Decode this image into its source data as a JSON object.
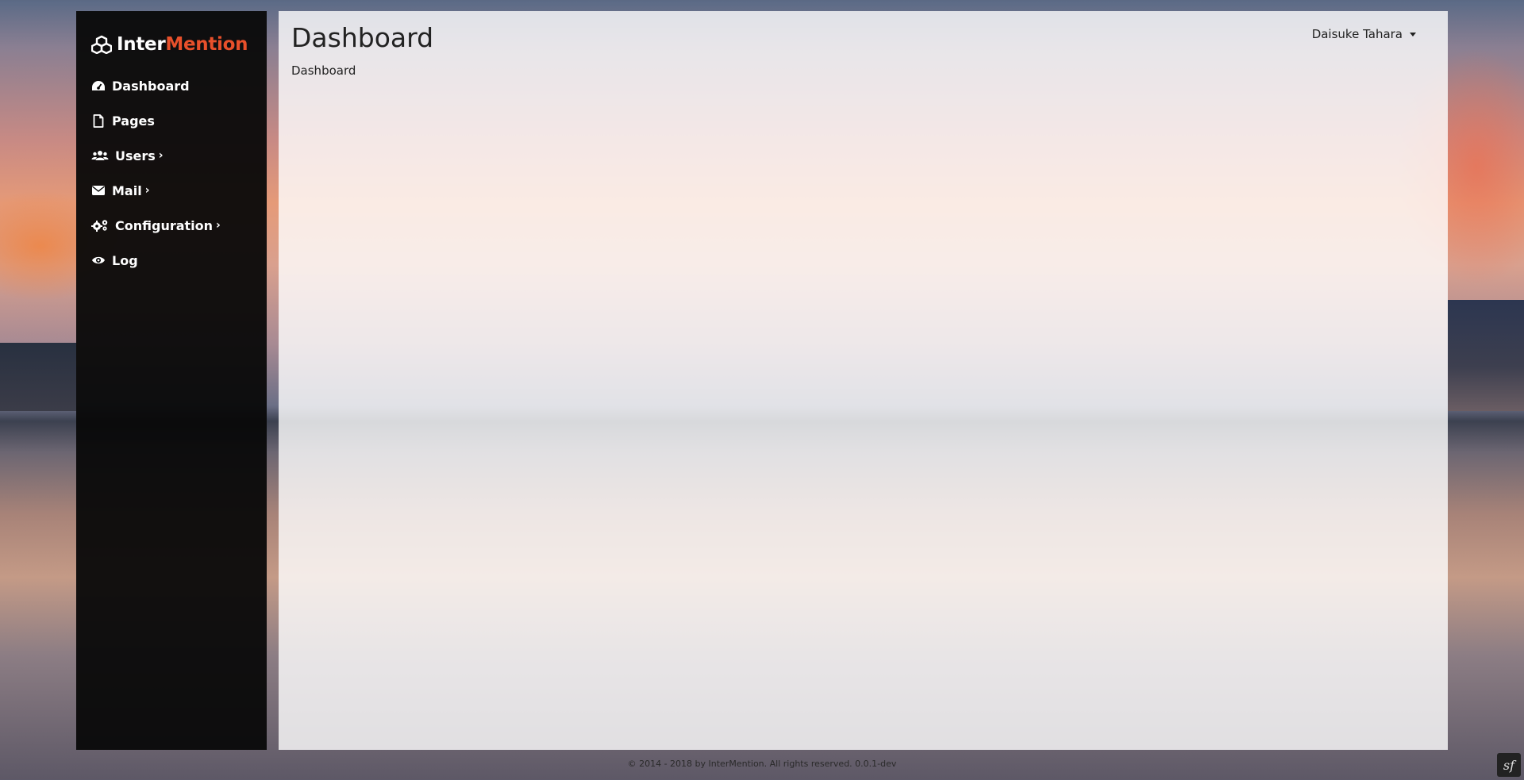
{
  "brand": {
    "part1": "Inter",
    "part2": "Mention",
    "accent_color": "#e8502b"
  },
  "sidebar": {
    "items": [
      {
        "label": "Dashboard",
        "icon": "tachometer-icon",
        "has_submenu": false
      },
      {
        "label": "Pages",
        "icon": "file-icon",
        "has_submenu": false
      },
      {
        "label": "Users",
        "icon": "users-icon",
        "has_submenu": true
      },
      {
        "label": "Mail",
        "icon": "envelope-icon",
        "has_submenu": true
      },
      {
        "label": "Configuration",
        "icon": "cogs-icon",
        "has_submenu": true
      },
      {
        "label": "Log",
        "icon": "eye-icon",
        "has_submenu": false
      }
    ],
    "submenu_glyph": "›"
  },
  "header": {
    "title": "Dashboard",
    "breadcrumb": "Dashboard",
    "user_name": "Daisuke Tahara"
  },
  "footer": {
    "text": "© 2014 - 2018 by InterMention. All rights reserved. 0.0.1-dev"
  },
  "debug_badge": {
    "glyph": "sf"
  }
}
